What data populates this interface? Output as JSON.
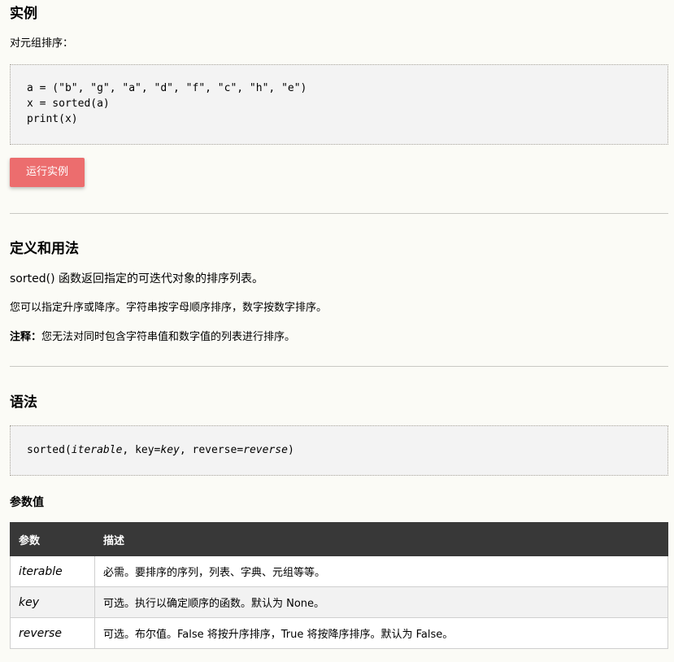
{
  "example": {
    "heading": "实例",
    "intro": "对元组排序：",
    "code_lines": [
      "a = (\"b\", \"g\", \"a\", \"d\", \"f\", \"c\", \"h\", \"e\")",
      "x = sorted(a)",
      "print(x)"
    ],
    "run_button": "运行实例",
    "button_color": "#ec6d6e"
  },
  "definition": {
    "heading": "定义和用法",
    "p1": "sorted() 函数返回指定的可迭代对象的排序列表。",
    "p2": "您可以指定升序或降序。字符串按字母顺序排序，数字按数字排序。",
    "note_label": "注释：",
    "note_text": "您无法对同时包含字符串值和数字值的列表进行排序。"
  },
  "syntax": {
    "heading": "语法",
    "fn": "sorted(",
    "arg1": "iterable",
    "sep1": ", key=",
    "arg2": "key",
    "sep2": ", reverse=",
    "arg3": "reverse",
    "close": ")"
  },
  "params": {
    "heading": "参数值",
    "columns": [
      "参数",
      "描述"
    ],
    "rows": [
      {
        "name": "iterable",
        "desc": "必需。要排序的序列，列表、字典、元组等等。"
      },
      {
        "name": "key",
        "desc": "可选。执行以确定顺序的函数。默认为 None。"
      },
      {
        "name": "reverse",
        "desc": "可选。布尔值。False 将按升序排序，True 将按降序排序。默认为 False。"
      }
    ],
    "header_bg": "#383838"
  }
}
